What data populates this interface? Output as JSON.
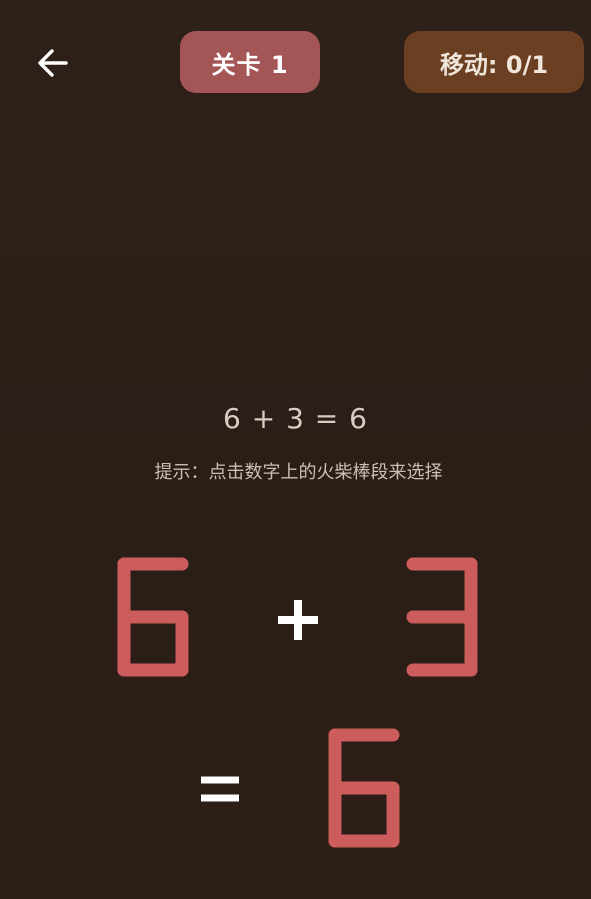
{
  "header": {
    "back_icon": "arrow-left-icon",
    "level_label": "关卡 1",
    "moves_label": "移动: 0/1"
  },
  "puzzle": {
    "equation_text": "6 + 3 = 6",
    "hint_text": "提示：点击数字上的火柴棒段来选择",
    "left_operand": "6",
    "operator": "+",
    "right_operand": "3",
    "equals_sign": "=",
    "result": "6"
  },
  "colors": {
    "matchstick": "#cd5c5c",
    "operator": "#ffffff",
    "level_badge": "#a45556",
    "moves_badge": "#6b3f22"
  }
}
